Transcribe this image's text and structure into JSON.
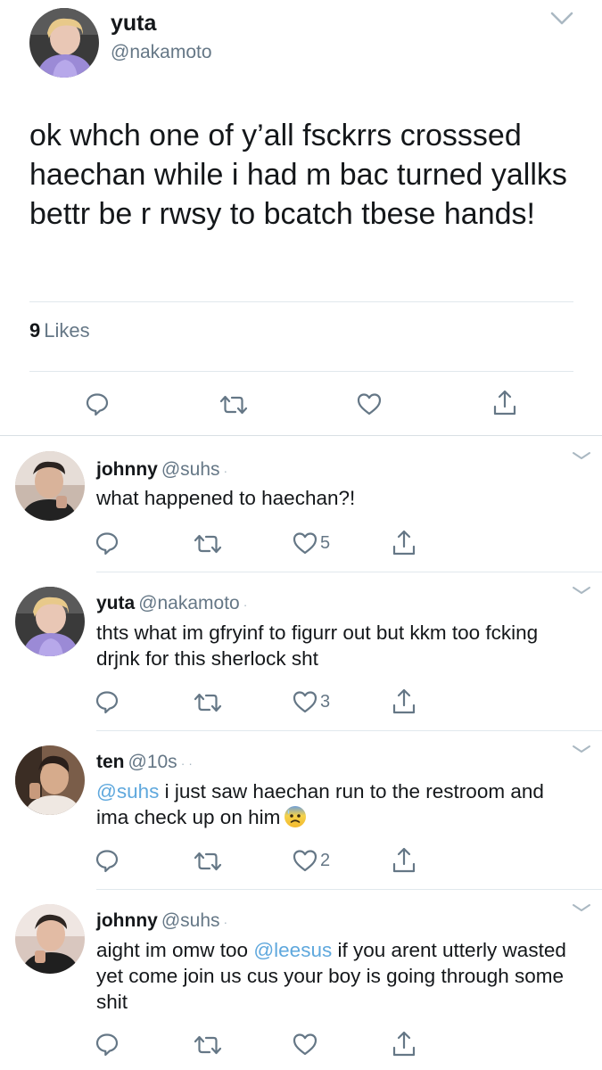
{
  "main_tweet": {
    "name": "yuta",
    "handle": "@nakamoto",
    "text": "ok whch one of y’all fsckrrs crosssed haechan while i had m bac turned yallks bettr be r rwsy to bcatch tbese hands!",
    "likes_count": "9",
    "likes_label": "Likes"
  },
  "replies": [
    {
      "name": "johnny",
      "handle": "@suhs",
      "dot": "·",
      "text": "what happened to haechan?!",
      "like_count": "5"
    },
    {
      "name": "yuta",
      "handle": "@nakamoto",
      "dot": "·",
      "text": "thts what im gfryinf to figurr out but kkm too fcking drjnk for this sherlock sht",
      "like_count": "3"
    },
    {
      "name": "ten",
      "handle": "@10s",
      "dot": "· ·",
      "mention": "@suhs",
      "text": " i just saw haechan run to the restroom and ima check up on him",
      "emoji": "anxious-face-with-sweat",
      "like_count": "2"
    },
    {
      "name": "johnny",
      "handle": "@suhs",
      "dot": "·",
      "text_before": "aight im omw too ",
      "mention": "@leesus",
      "text_after": " if you arent utterly wasted yet come join us cus your boy is going through some shit",
      "like_count": ""
    }
  ],
  "icons": {
    "reply": "reply-bubble-icon",
    "retweet": "retweet-icon",
    "like": "heart-icon",
    "share": "share-icon",
    "caret": "chevron-down-icon"
  },
  "colors": {
    "icon_gray": "#657786",
    "mention_blue": "#5fa8dd",
    "divider": "#e1e8ed"
  }
}
